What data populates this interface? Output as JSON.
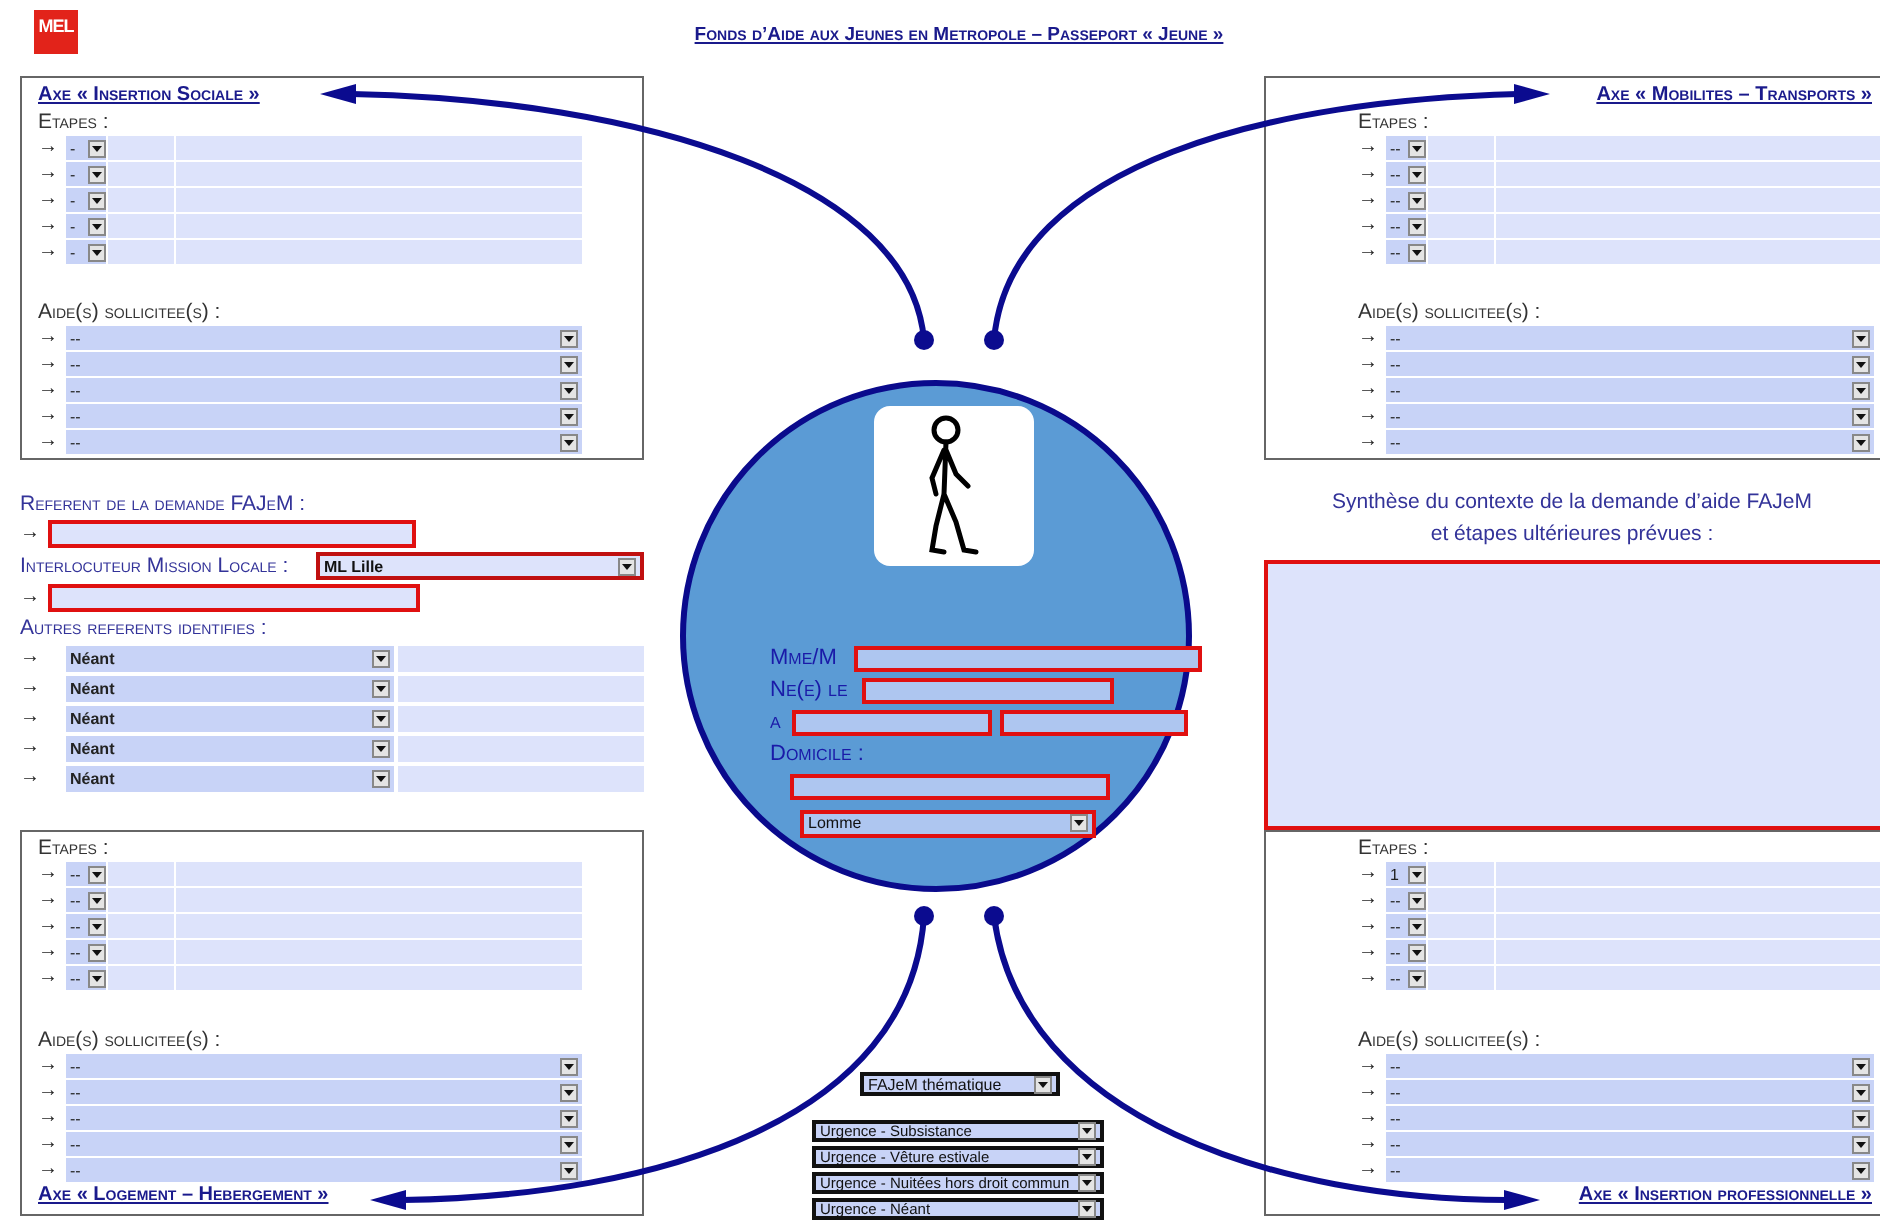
{
  "header": {
    "logo": "MEL",
    "title": "Fonds d’Aide aux Jeunes en Metropole – Passeport «  Jeune »"
  },
  "top_axes": [
    {
      "title": "Axe « Insertion Sociale »",
      "kind": "left",
      "etapes_label": "Etapes :",
      "etapes": [
        {
          "bullet": "→",
          "value": "-"
        },
        {
          "bullet": "→",
          "value": "-"
        },
        {
          "bullet": "→",
          "value": "-"
        },
        {
          "bullet": "→",
          "value": "-"
        },
        {
          "bullet": "→",
          "value": "-"
        }
      ],
      "aides_label": "Aide(s) sollicitee(s) :",
      "aides": [
        {
          "bullet": "→",
          "value": "--"
        },
        {
          "bullet": "→",
          "value": "--"
        },
        {
          "bullet": "→",
          "value": "--"
        },
        {
          "bullet": "→",
          "value": "--"
        },
        {
          "bullet": "→",
          "value": "--"
        }
      ]
    },
    {
      "title": "Axe « Mobilites – Transports »",
      "kind": "right",
      "etapes_label": "Etapes :",
      "etapes": [
        {
          "bullet": "→",
          "value": "--"
        },
        {
          "bullet": "→",
          "value": "--"
        },
        {
          "bullet": "→",
          "value": "--"
        },
        {
          "bullet": "→",
          "value": "--"
        },
        {
          "bullet": "→",
          "value": "--"
        }
      ],
      "aides_label": "Aide(s) sollicitee(s) :",
      "aides": [
        {
          "bullet": "→",
          "value": "--"
        },
        {
          "bullet": "→",
          "value": "--"
        },
        {
          "bullet": "→",
          "value": "--"
        },
        {
          "bullet": "→",
          "value": "--"
        },
        {
          "bullet": "→",
          "value": "--"
        }
      ]
    }
  ],
  "referents": {
    "referent_label": "Referent de la demande FAJeM :",
    "referent_bullet": "→",
    "interlocuteur_label": "Interlocuteur Mission Locale :",
    "interlocuteur_value": "ML Lille",
    "interlocuteur_bullet": "→",
    "autres_label": "Autres referents identifies :",
    "autres": [
      {
        "bullet": "→",
        "value": "Néant"
      },
      {
        "bullet": "→",
        "value": "Néant"
      },
      {
        "bullet": "→",
        "value": "Néant"
      },
      {
        "bullet": "→",
        "value": "Néant"
      },
      {
        "bullet": "→",
        "value": "Néant"
      }
    ]
  },
  "person": {
    "name_label": "Mme/M",
    "born_label": "Ne(e) le",
    "place_label": "a",
    "home_label": "Domicile :",
    "city": "Lomme"
  },
  "synthese": {
    "title_lines": [
      "Synthèse du contexte de la demande d’aide FAJeM",
      "et étapes ultérieures prévues :"
    ]
  },
  "bottom_axes": [
    {
      "title": "Axe « Logement – Hebergement »",
      "kind": "left",
      "etapes_label": "Etapes :",
      "etapes": [
        {
          "bullet": "→",
          "value": "--"
        },
        {
          "bullet": "→",
          "value": "--"
        },
        {
          "bullet": "→",
          "value": "--"
        },
        {
          "bullet": "→",
          "value": "--"
        },
        {
          "bullet": "→",
          "value": "--"
        }
      ],
      "aides_label": "Aide(s) sollicitee(s) :",
      "aides": [
        {
          "bullet": "→",
          "value": "--"
        },
        {
          "bullet": "→",
          "value": "--"
        },
        {
          "bullet": "→",
          "value": "--"
        },
        {
          "bullet": "→",
          "value": "--"
        },
        {
          "bullet": "→",
          "value": "--"
        }
      ]
    },
    {
      "title": "Axe « Insertion professionnelle »",
      "kind": "right",
      "etapes_label": "Etapes :",
      "etapes": [
        {
          "bullet": "→",
          "value": "1"
        },
        {
          "bullet": "→",
          "value": "--"
        },
        {
          "bullet": "→",
          "value": "--"
        },
        {
          "bullet": "→",
          "value": "--"
        },
        {
          "bullet": "→",
          "value": "--"
        }
      ],
      "aides_label": "Aide(s) sollicitee(s) :",
      "aides": [
        {
          "bullet": "→",
          "value": "--"
        },
        {
          "bullet": "→",
          "value": "--"
        },
        {
          "bullet": "→",
          "value": "--"
        },
        {
          "bullet": "→",
          "value": "--"
        },
        {
          "bullet": "→",
          "value": "--"
        }
      ]
    }
  ],
  "aid_types": {
    "thematic": "FAJeM thématique",
    "urgences": [
      "Urgence - Subsistance",
      "Urgence - Vêture estivale",
      "Urgence - Nuitées hors droit commun",
      "Urgence - Néant"
    ]
  }
}
